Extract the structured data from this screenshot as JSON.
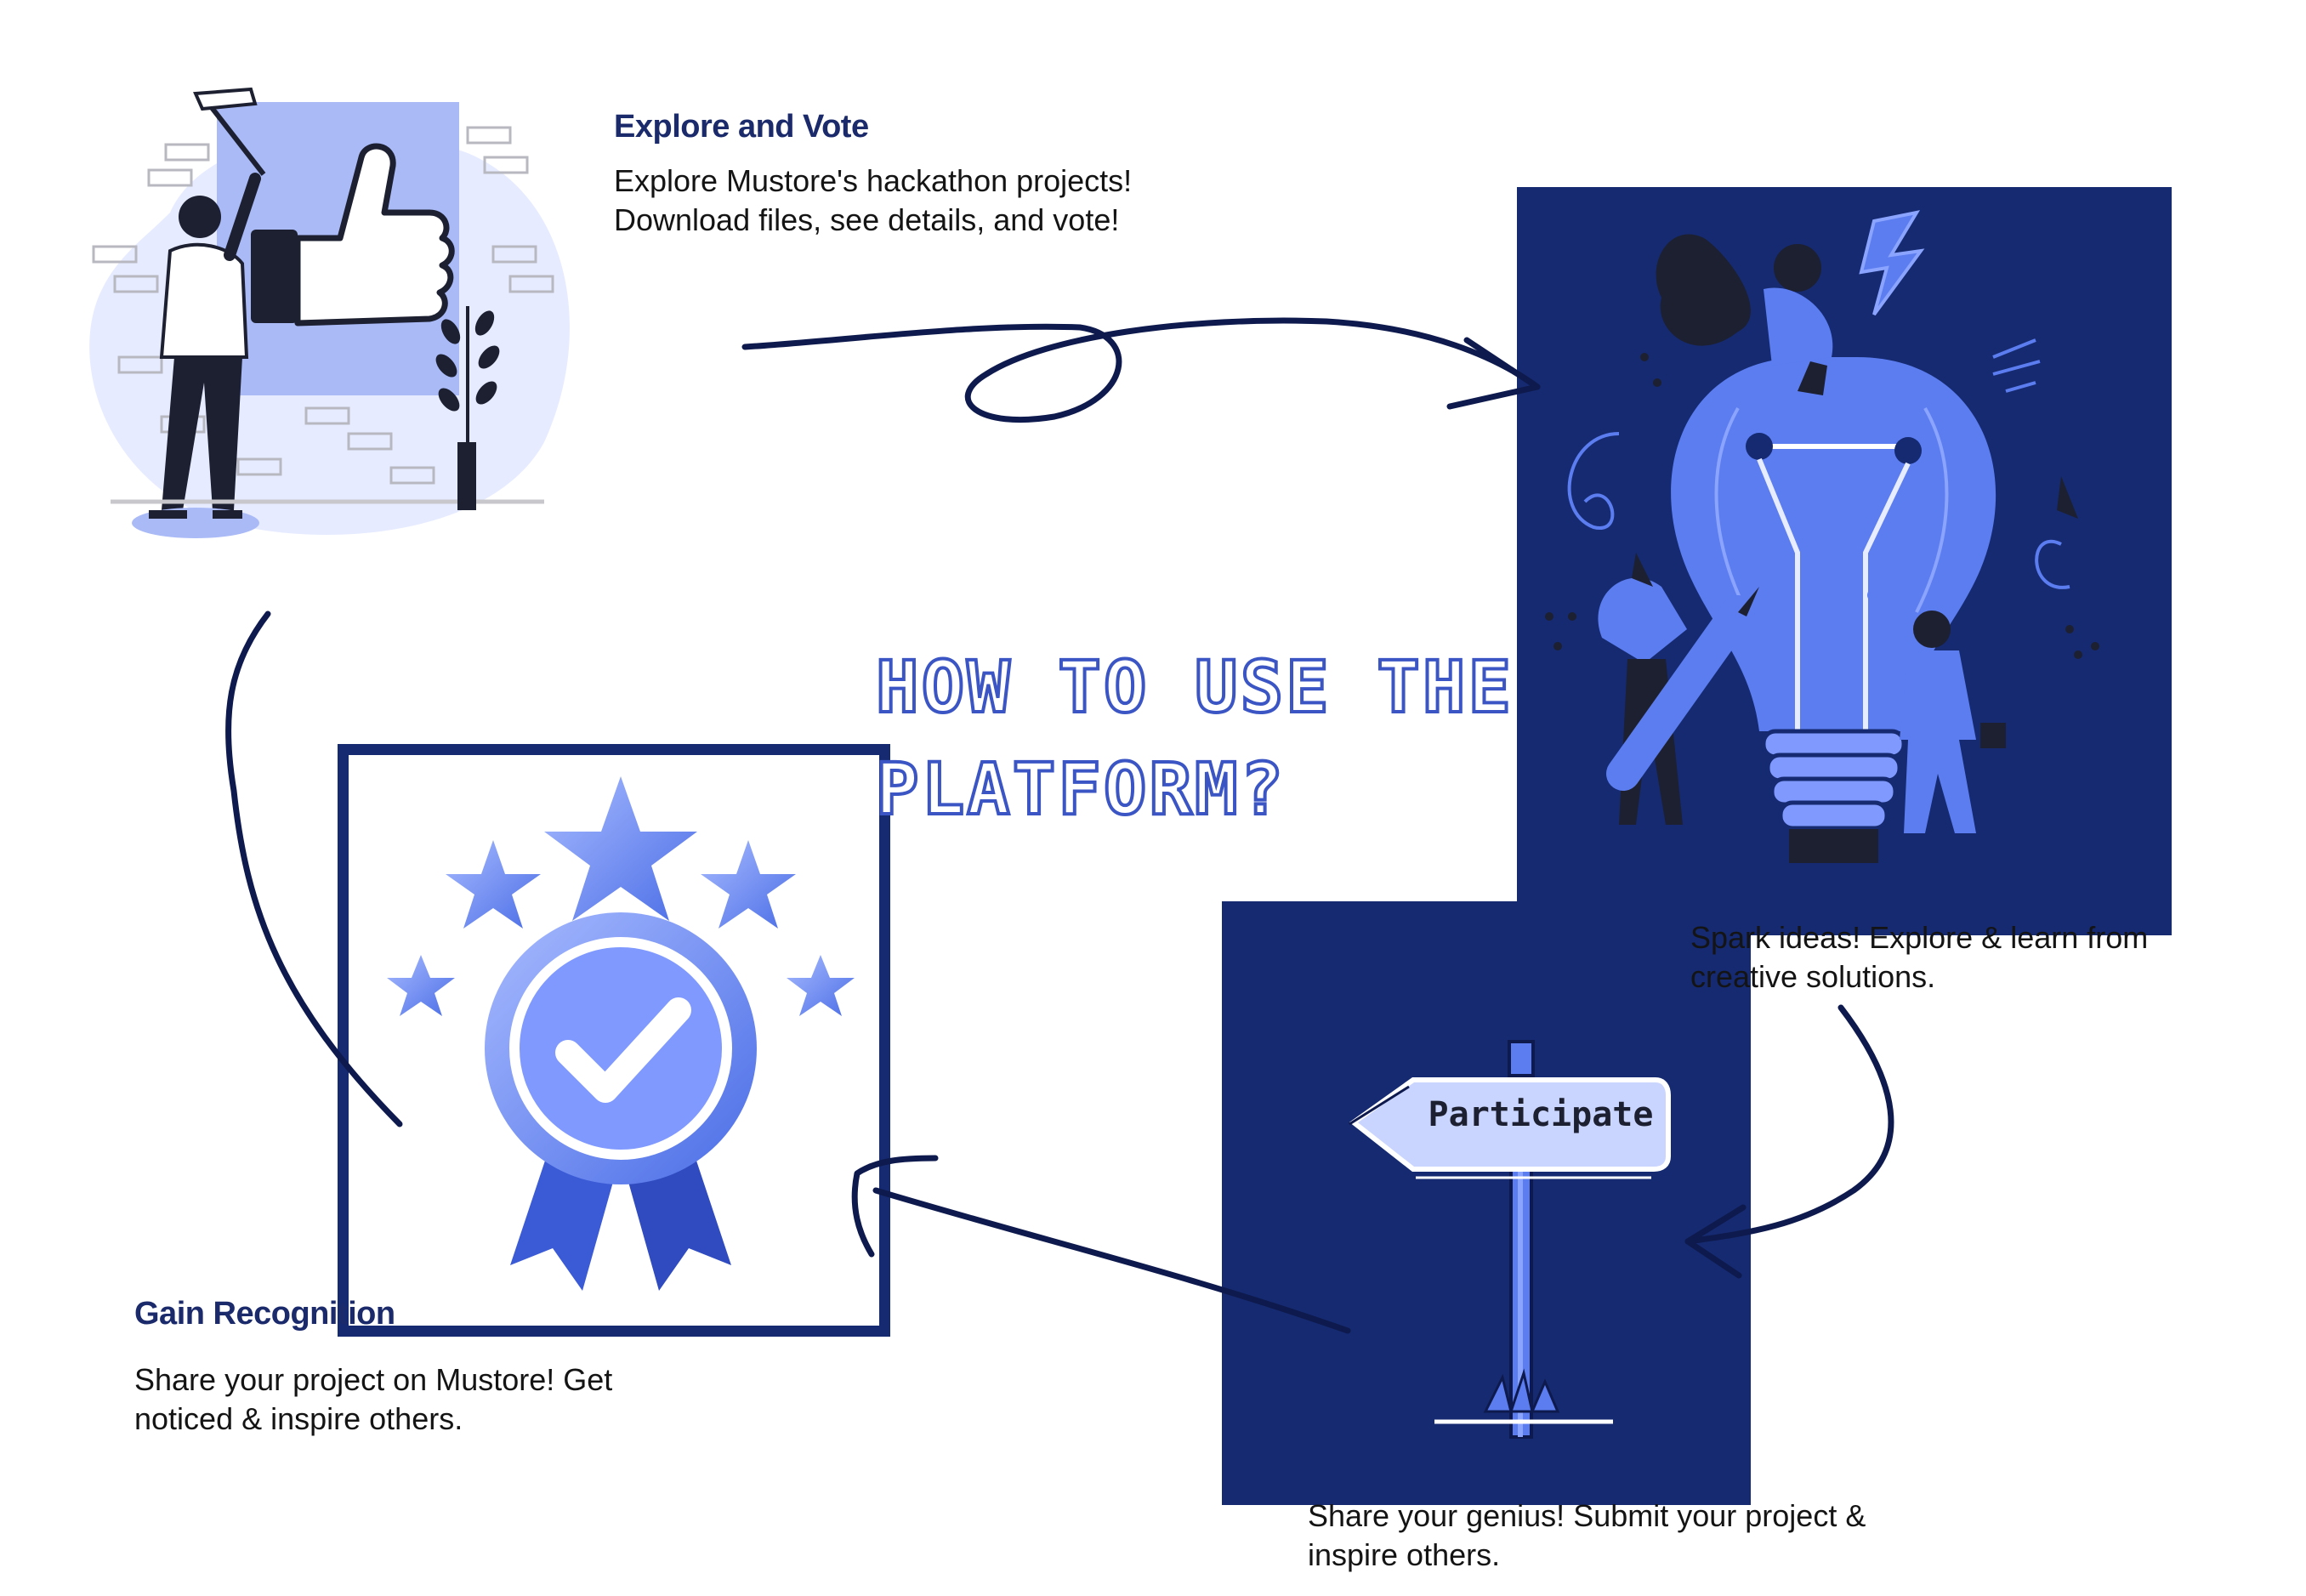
{
  "heading": {
    "line1": "How to use the",
    "line2": "platform?"
  },
  "steps": {
    "explore_vote": {
      "title": "Explore and Vote",
      "line1": "Explore Mustore's hackathon projects!",
      "line2": "Download files, see details, and vote!"
    },
    "spark": {
      "line1": "Spark ideas! Explore & learn from",
      "line2": "creative solutions."
    },
    "participate": {
      "sign_label": "Participate",
      "line1": "Share your genius! Submit your project &",
      "line2": "inspire others."
    },
    "recognition": {
      "title": "Gain Recognition",
      "line1": "Share your project on Mustore! Get",
      "line2": "noticed & inspire others."
    }
  },
  "colors": {
    "navy": "#152a70",
    "title_navy": "#1b2a6b",
    "accent_blue": "#5b7df0",
    "light_blue": "#c9d4ff",
    "text": "#141414"
  },
  "icons": [
    "thumbs-up-illustration",
    "lightbulb-illustration",
    "signpost-illustration",
    "award-badge-illustration",
    "flow-arrow"
  ]
}
